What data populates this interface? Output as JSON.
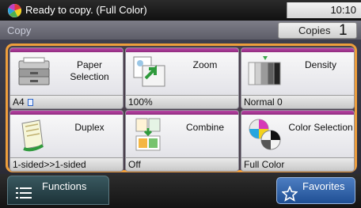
{
  "status": {
    "message": "Ready to copy. (Full Color)",
    "time": "10:10"
  },
  "mode": {
    "label": "Copy",
    "copies_label": "Copies",
    "copies_value": "1"
  },
  "tiles": [
    {
      "label": "Paper Selection",
      "value": "A4",
      "icon": "paper-tray-icon"
    },
    {
      "label": "Zoom",
      "value": "100%",
      "icon": "zoom-icon"
    },
    {
      "label": "Density",
      "value": "Normal 0",
      "icon": "density-icon"
    },
    {
      "label": "Duplex",
      "value": "1-sided>>1-sided",
      "icon": "duplex-icon"
    },
    {
      "label": "Combine",
      "value": "Off",
      "icon": "combine-icon"
    },
    {
      "label": "Color Selection",
      "value": "Full Color",
      "icon": "color-selection-icon"
    }
  ],
  "bottom": {
    "functions_label": "Functions",
    "favorites_label": "Favorites"
  },
  "colors": {
    "accent_frame": "#ee9e3c",
    "tile_stripe": "#a53894",
    "favorites_blue": "#2f61a8"
  }
}
